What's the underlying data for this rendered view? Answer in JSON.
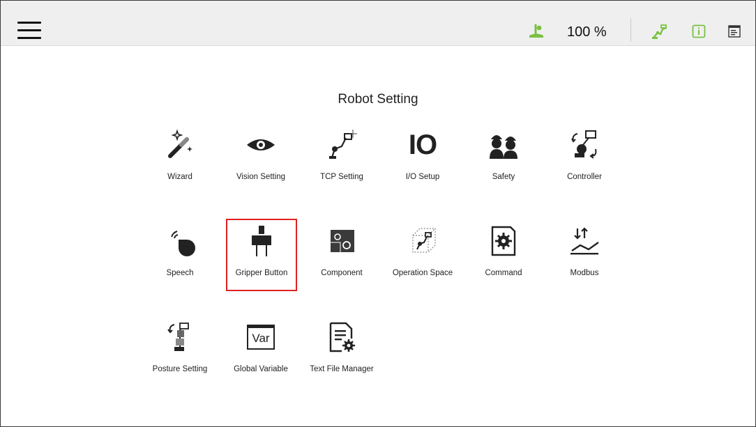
{
  "header": {
    "speed": "100 %",
    "icons": [
      "robot-status-icon",
      "robot-arm-icon",
      "info-icon",
      "log-icon"
    ],
    "accent_color": "#7ac143"
  },
  "main": {
    "title": "Robot Setting",
    "selected": "Gripper Button",
    "items": [
      {
        "label": "Wizard",
        "icon": "wand-icon"
      },
      {
        "label": "Vision Setting",
        "icon": "eye-icon"
      },
      {
        "label": "TCP Setting",
        "icon": "tcp-icon"
      },
      {
        "label": "I/O Setup",
        "icon": "io-icon"
      },
      {
        "label": "Safety",
        "icon": "safety-icon"
      },
      {
        "label": "Controller",
        "icon": "controller-icon"
      },
      {
        "label": "Speech",
        "icon": "speech-icon"
      },
      {
        "label": "Gripper Button",
        "icon": "gripper-icon"
      },
      {
        "label": "Component",
        "icon": "component-icon"
      },
      {
        "label": "Operation Space",
        "icon": "operation-space-icon"
      },
      {
        "label": "Command",
        "icon": "command-icon"
      },
      {
        "label": "Modbus",
        "icon": "modbus-icon"
      },
      {
        "label": "Posture Setting",
        "icon": "posture-icon"
      },
      {
        "label": "Global Variable",
        "icon": "variable-icon"
      },
      {
        "label": "Text File Manager",
        "icon": "text-file-icon"
      }
    ],
    "variable_icon_text": "Var",
    "io_icon_text": "IO"
  }
}
